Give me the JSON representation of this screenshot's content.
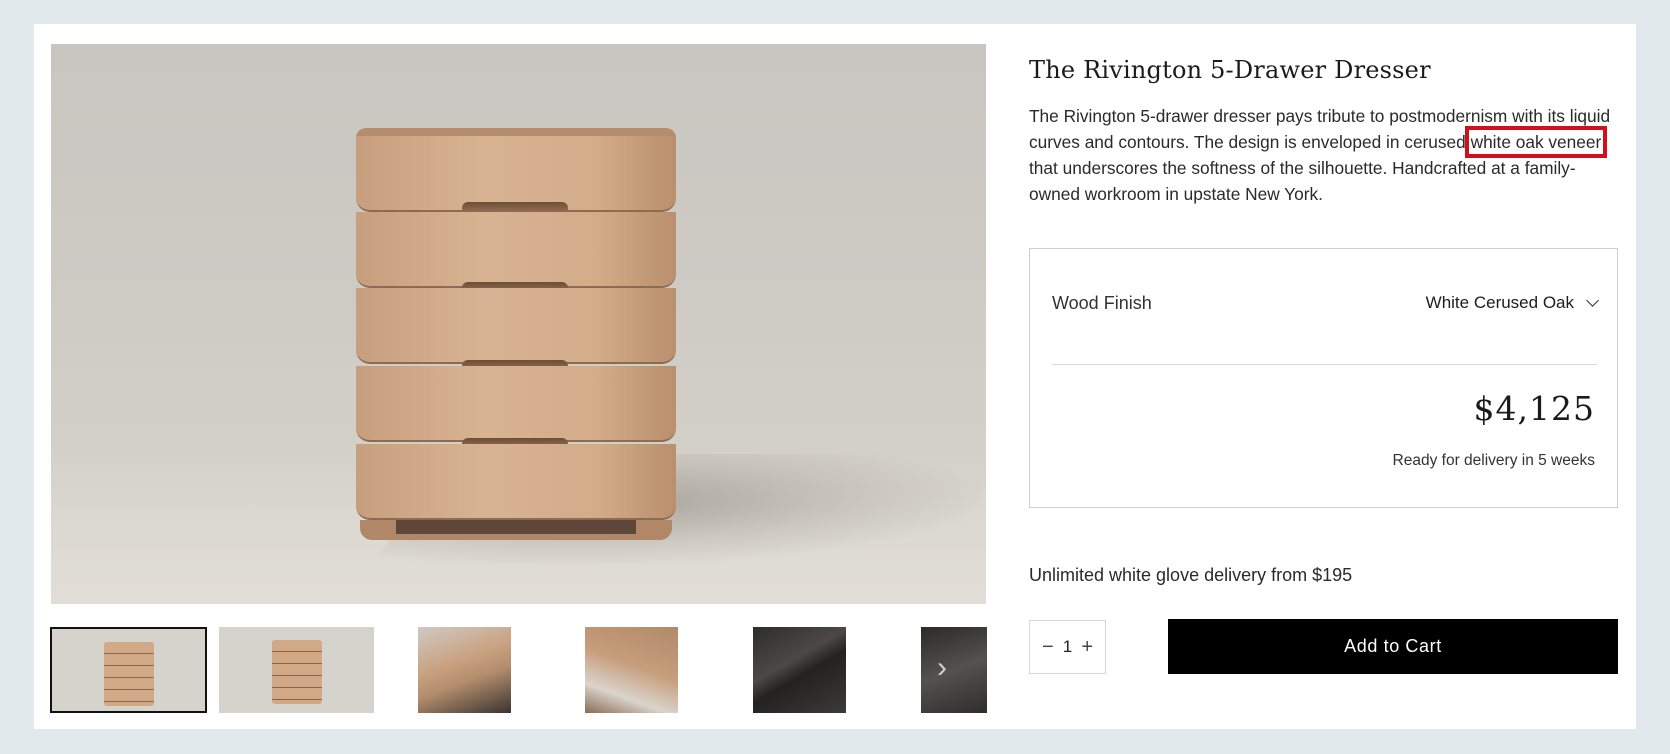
{
  "product": {
    "title": "The Rivington 5-Drawer Dresser",
    "description_before": "The Rivington 5-drawer dresser pays tribute to postmodernism with its liquid curves and contours. The design is enveloped in cerused ",
    "description_highlight": "white oak veneer",
    "description_after": " that underscores the softness of the silhouette. Handcrafted at a family-owned workroom in upstate New York."
  },
  "gallery": {
    "selected_index": 0,
    "thumbnails": [
      "front-view",
      "front-view-angle",
      "top-corner-detail",
      "drawer-open-detail",
      "dark-finish-detail",
      "dark-finish-detail-2"
    ]
  },
  "options": {
    "finish_label": "Wood Finish",
    "finish_value": "White Cerused Oak",
    "price": "$4,125",
    "delivery_eta": "Ready for delivery in 5 weeks"
  },
  "shipping": {
    "text": "Unlimited white glove delivery from $195"
  },
  "cart": {
    "quantity": "1",
    "minus": "−",
    "plus": "+",
    "add_label": "Add to Cart"
  },
  "colors": {
    "highlight_box": "#d0101a",
    "button_bg": "#000000",
    "page_bg": "#e2e9ec"
  }
}
